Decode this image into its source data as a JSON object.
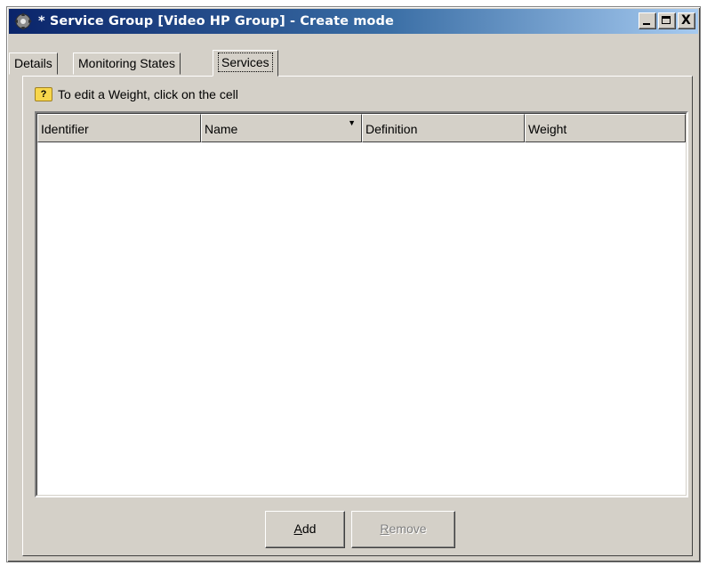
{
  "window": {
    "title": "* Service Group [Video HP Group] - Create mode",
    "controls": {
      "minimize_icon": "minimize-icon",
      "maximize_icon": "maximize-icon",
      "close_label": "X"
    }
  },
  "tabs": [
    {
      "label": "Details",
      "active": false
    },
    {
      "label": "Monitoring States",
      "active": false
    },
    {
      "label": "Services",
      "active": true
    }
  ],
  "services_tab": {
    "hint": "To edit a Weight, click on the cell",
    "hint_icon": "tip-icon",
    "table": {
      "columns": [
        "Identifier",
        "Name",
        "Definition",
        "Weight"
      ],
      "sort_column": "Name",
      "sort_indicator": "▼",
      "rows": []
    },
    "buttons": {
      "add": {
        "mnemonic": "A",
        "rest": "dd",
        "enabled": true
      },
      "remove": {
        "mnemonic": "R",
        "rest": "emove",
        "enabled": false
      }
    }
  },
  "colors": {
    "title_gradient_start": "#0a246a",
    "title_gradient_end": "#a6caf0",
    "face": "#d4d0c8"
  }
}
